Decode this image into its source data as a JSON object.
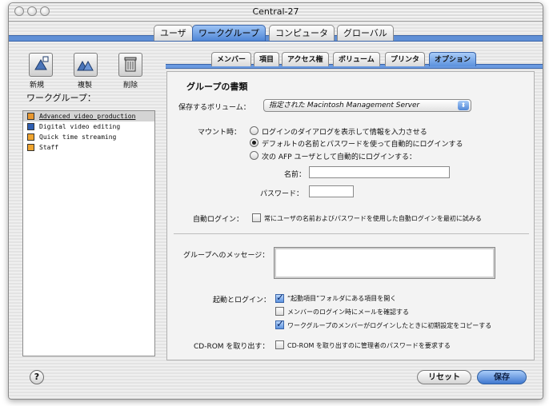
{
  "window": {
    "title": "Central-27"
  },
  "top_tabs": [
    {
      "label": "ユーザ"
    },
    {
      "label": "ワークグループ"
    },
    {
      "label": "コンピュータ"
    },
    {
      "label": "グローバル"
    }
  ],
  "toolbar": {
    "new_label": "新規",
    "duplicate_label": "複製",
    "delete_label": "削除"
  },
  "workgroups": {
    "label": "ワークグループ：",
    "items": [
      {
        "name": "Advanced video production"
      },
      {
        "name": "Digital video editing"
      },
      {
        "name": "Quick time streaming"
      },
      {
        "name": "Staff"
      }
    ]
  },
  "sub_tabs": [
    {
      "label": "メンバー"
    },
    {
      "label": "項目"
    },
    {
      "label": "アクセス権"
    },
    {
      "label": "ボリューム"
    },
    {
      "label": "プリンタ"
    },
    {
      "label": "オプション"
    }
  ],
  "options": {
    "section_title": "グループの書類",
    "volume_label": "保存するボリューム：",
    "volume_value": "指定された Macintosh Management Server",
    "mount_label": "マウント時：",
    "mount_options": [
      "ログインのダイアログを表示して情報を入力させる",
      "デフォルトの名前とパスワードを使って自動的にログインする",
      "次の AFP ユーザとして自動的にログインする："
    ],
    "name_label": "名前：",
    "password_label": "パスワード：",
    "name_value": "",
    "password_value": "",
    "auto_login_label": "自動ログイン：",
    "auto_login_text": "常にユーザの名前およびパスワードを使用した自動ログインを最初に試みる",
    "message_label": "グループへのメッセージ：",
    "message_value": "",
    "startup_label": "起動とログイン：",
    "startup_options": [
      "“起動項目”フォルダにある項目を開く",
      "メンバーのログイン時にメールを確認する",
      "ワークグループのメンバーがログインしたときに初期設定をコピーする"
    ],
    "cdrom_label": "CD-ROM を取り出す：",
    "cdrom_text": "CD-ROM を取り出すのに管理者のパスワードを要求する"
  },
  "buttons": {
    "reset_label": "リセット",
    "save_label": "保存",
    "help_label": "?"
  }
}
